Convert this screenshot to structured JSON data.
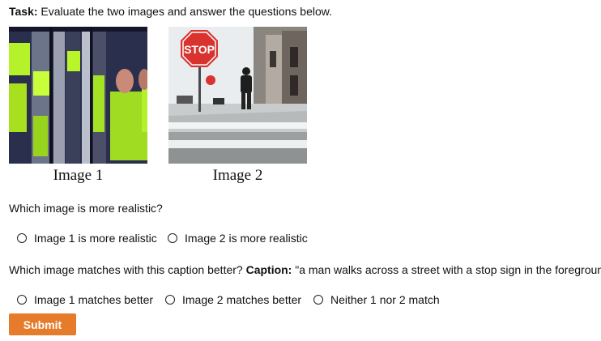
{
  "task": {
    "label": "Task:",
    "text": " Evaluate the two images and answer the questions below."
  },
  "images": [
    {
      "caption": "Image 1"
    },
    {
      "caption": "Image 2",
      "sign_text": "STOP"
    }
  ],
  "question1": {
    "text": "Which image is more realistic?",
    "options": [
      "Image 1 is more realistic",
      "Image 2 is more realistic"
    ]
  },
  "question2": {
    "text": "Which image matches with this caption better? ",
    "caption_label": "Caption:",
    "caption_text": " \"a man walks across a street with a stop sign in the foreground.\"",
    "options": [
      "Image 1 matches better",
      "Image 2 matches better",
      "Neither 1 nor 2 match"
    ]
  },
  "submit_label": "Submit",
  "colors": {
    "accent": "#e57b2b"
  }
}
